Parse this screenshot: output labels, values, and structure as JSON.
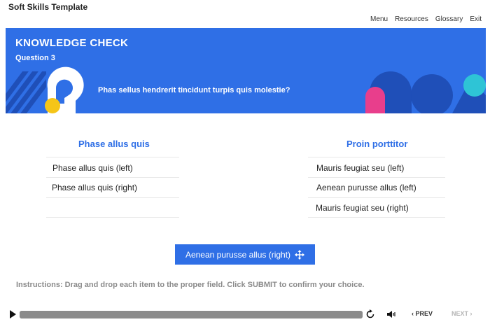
{
  "app": {
    "title": "Soft Skills Template"
  },
  "nav": {
    "items": [
      "Menu",
      "Resources",
      "Glossary",
      "Exit"
    ]
  },
  "banner": {
    "title": "KNOWLEDGE CHECK",
    "subtitle": "Question 3",
    "question": "Phas sellus hendrerit tincidunt turpis quis molestie?",
    "colors": {
      "background": "#2f6fe6",
      "yellow": "#f5c518",
      "pink": "#e83e8c",
      "teal": "#2ec4d6",
      "navy": "#1f4fb8"
    }
  },
  "columns": [
    {
      "heading": "Phase allus quis",
      "items": [
        "Phase allus quis (left)",
        "Phase allus quis (right)"
      ]
    },
    {
      "heading": "Proin porttitor",
      "items": [
        "Mauris feugiat seu (left)",
        "Aenean purusse allus (left)",
        "Mauris feugiat seu (right)"
      ]
    }
  ],
  "drag_item": {
    "label": "Aenean purusse allus (right)",
    "icon": "move-icon"
  },
  "instructions": "Instructions: Drag and drop each item to the proper field. Click SUBMIT to confirm your choice.",
  "player": {
    "progress_percent": 100,
    "prev_label": "PREV",
    "next_label": "NEXT"
  }
}
